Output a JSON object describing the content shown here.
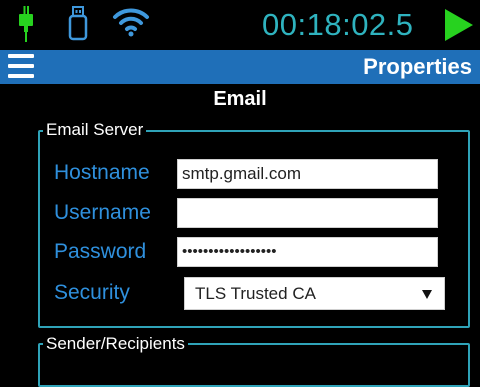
{
  "status": {
    "timer": "00:18:02.5",
    "icons": [
      "usb-plug-icon",
      "usb-drive-icon",
      "wifi-icon",
      "play-icon"
    ],
    "colors": {
      "accent": "#2fb3bf",
      "play": "#27d21f",
      "plug": "#27d21f",
      "titlebar": "#1f6fb8"
    }
  },
  "header": {
    "title": "Properties",
    "menu_icon": "hamburger-icon"
  },
  "page": {
    "heading": "Email"
  },
  "email_server": {
    "legend": "Email Server",
    "hostname_label": "Hostname",
    "hostname_value": "smtp.gmail.com",
    "username_label": "Username",
    "username_value": "",
    "password_label": "Password",
    "password_value": "••••••••••••••••••",
    "security_label": "Security",
    "security_value": "TLS Trusted CA"
  },
  "sender_recipients": {
    "legend": "Sender/Recipients"
  }
}
